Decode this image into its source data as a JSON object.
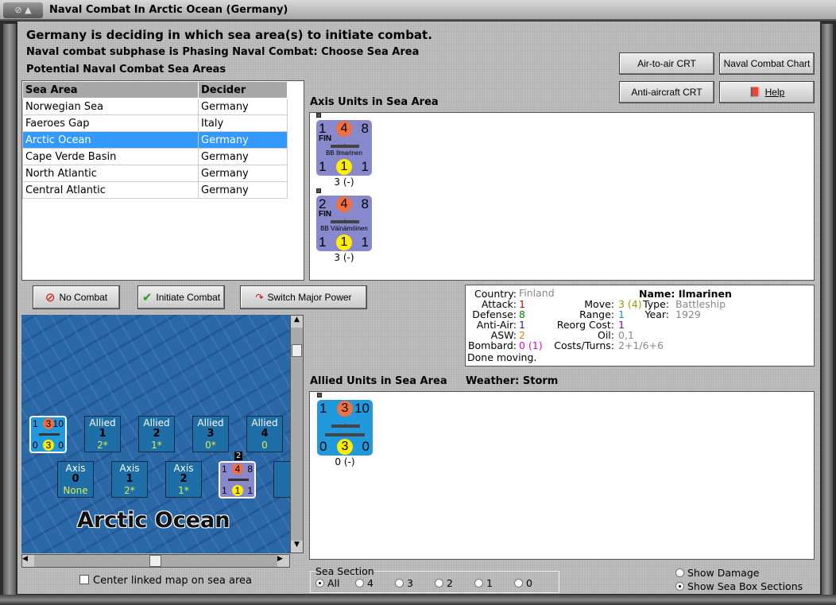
{
  "window": {
    "title": "Naval Combat In Arctic Ocean (Germany)"
  },
  "header": {
    "status": "Germany is deciding in which sea area(s) to initiate combat.",
    "subphase": "Naval combat subphase is Phasing Naval Combat: Choose Sea Area",
    "list_title": "Potential Naval Combat Sea Areas"
  },
  "toolbar": {
    "air_crt": "Air-to-air CRT",
    "naval_chart": "Naval Combat Chart",
    "aa_crt": "Anti-aircraft CRT",
    "help": "Help"
  },
  "sea_table": {
    "headers": [
      "Sea Area",
      "Decider"
    ],
    "rows": [
      {
        "area": "Norwegian Sea",
        "decider": "Germany"
      },
      {
        "area": "Faeroes Gap",
        "decider": "Italy"
      },
      {
        "area": "Arctic Ocean",
        "decider": "Germany",
        "selected": true
      },
      {
        "area": "Cape Verde Basin",
        "decider": "Germany"
      },
      {
        "area": "North Atlantic",
        "decider": "Germany"
      },
      {
        "area": "Central Atlantic",
        "decider": "Germany"
      }
    ]
  },
  "actions": {
    "no_combat": "No Combat",
    "initiate": "Initiate Combat",
    "switch": "Switch Major Power"
  },
  "axis": {
    "title": "Axis Units in Sea Area",
    "units": [
      {
        "tl": "1",
        "attack": "4",
        "tr": "8",
        "nation": "FIN",
        "name": "BB Ilmarinen",
        "bl": "1",
        "mid": "1",
        "br": "1",
        "status": "3 (-)"
      },
      {
        "tl": "2",
        "attack": "4",
        "tr": "8",
        "nation": "FIN",
        "name": "BB Väinämöinen",
        "bl": "1",
        "mid": "1",
        "br": "1",
        "status": "3 (-)"
      }
    ]
  },
  "info": {
    "country_l": "Country:",
    "country": "Finland",
    "attack_l": "Attack:",
    "attack": "1",
    "defense_l": "Defense:",
    "defense": "8",
    "aa_l": "Anti-Air:",
    "aa": "1",
    "asw_l": "ASW:",
    "asw": "2",
    "bombard_l": "Bombard:",
    "bombard": "0 (1)",
    "move_l": "Move:",
    "move": "3 (4)",
    "range_l": "Range:",
    "range": "1",
    "reorg_l": "Reorg Cost:",
    "reorg": "1",
    "oil_l": "Oil:",
    "oil": "0,1",
    "costs_l": "Costs/Turns:",
    "costs": "2+1/6+6",
    "name": "Name: Ilmarinen",
    "type_l": "Type:",
    "type": "Battleship",
    "year_l": "Year:",
    "year": "1929",
    "done": "Done moving."
  },
  "allied": {
    "title": "Allied Units in Sea Area",
    "weather": "Weather:  Storm",
    "units": [
      {
        "tl": "1",
        "attack": "3",
        "tr": "10",
        "bl": "0",
        "mid": "3",
        "br": "0",
        "status": "0 (-)"
      }
    ]
  },
  "map": {
    "sea_name": "Arctic Ocean",
    "allied_boxes": [
      {
        "label": "Allied",
        "num": "1",
        "val": "2*"
      },
      {
        "label": "Allied",
        "num": "2",
        "val": "1*"
      },
      {
        "label": "Allied",
        "num": "3",
        "val": "0*"
      },
      {
        "label": "Allied",
        "num": "4",
        "val": "0"
      }
    ],
    "axis_boxes": [
      {
        "label": "Axis",
        "num": "0",
        "val": "None"
      },
      {
        "label": "Axis",
        "num": "1",
        "val": "2*"
      },
      {
        "label": "Axis",
        "num": "2",
        "val": "1*"
      }
    ],
    "stack_count": "2",
    "center_label": "Center linked map on sea area"
  },
  "sea_section": {
    "legend": "Sea Section",
    "options": [
      "All",
      "4",
      "3",
      "2",
      "1",
      "0"
    ],
    "selected": "All"
  },
  "view": {
    "show_damage": "Show Damage",
    "show_boxes": "Show Sea Box Sections",
    "selected": "Show Sea Box Sections"
  }
}
